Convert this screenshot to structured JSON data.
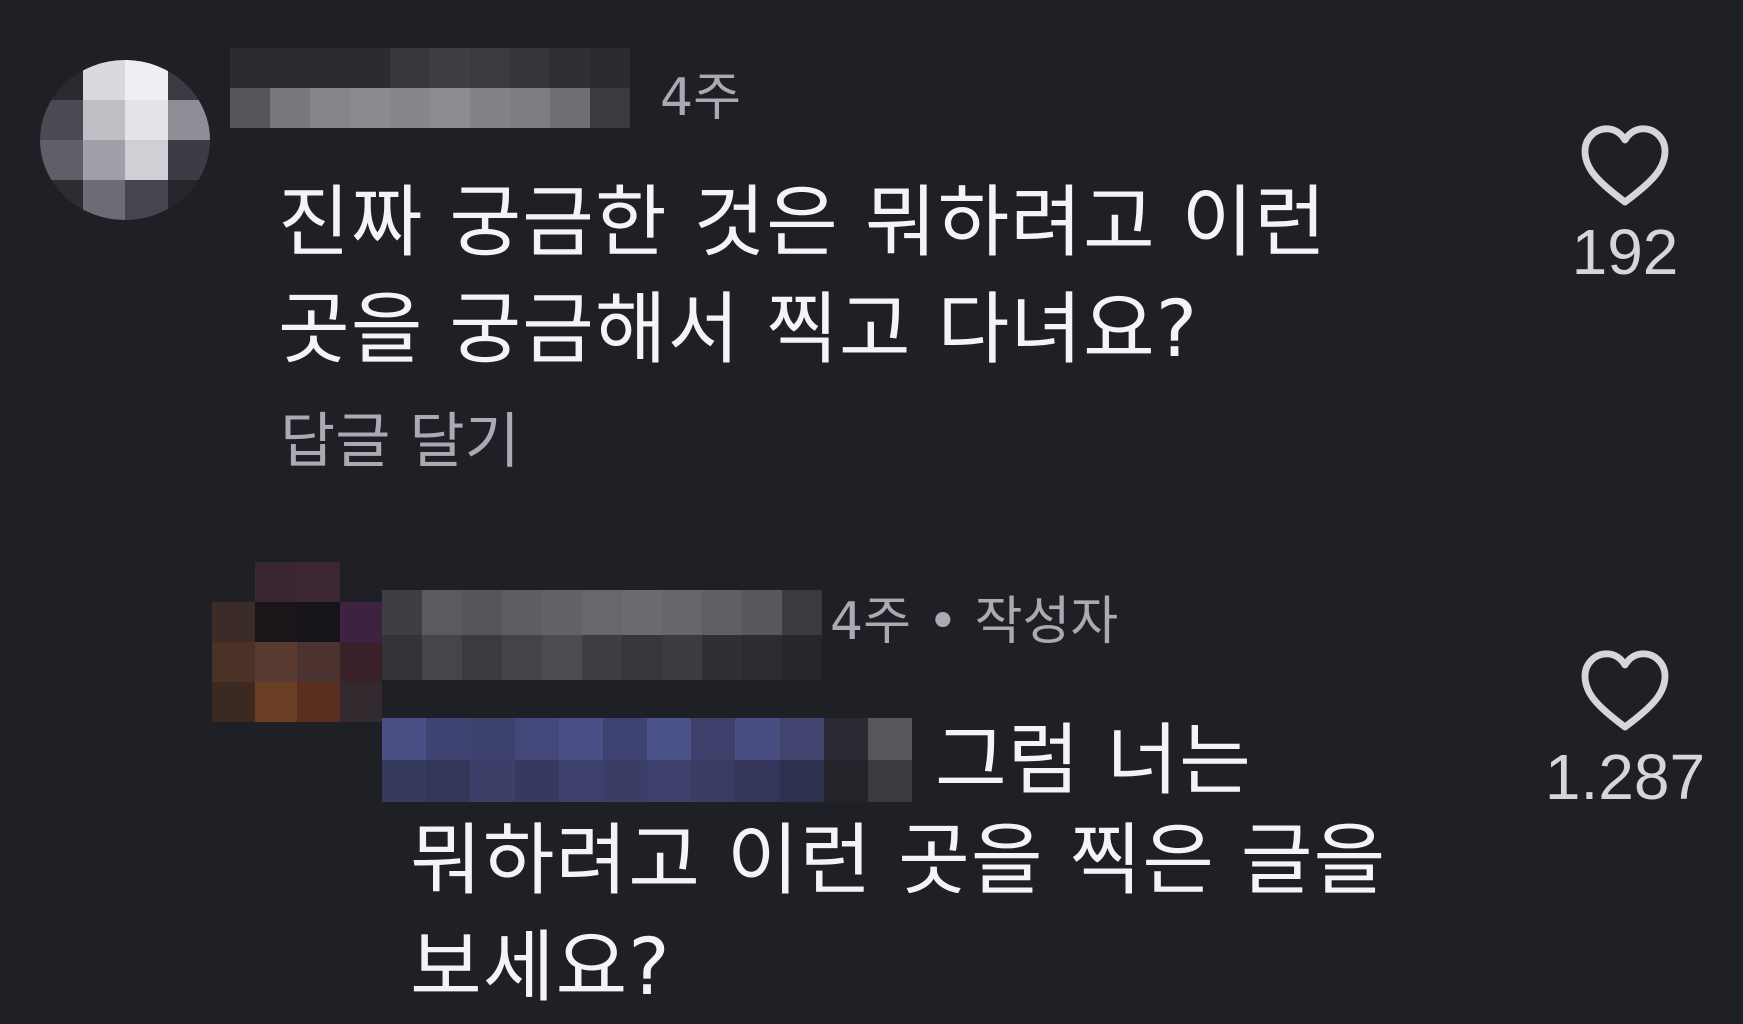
{
  "comments": [
    {
      "time": "4주",
      "author_badge": "",
      "text": "진짜 궁금한 것은 뭐하려고 이런\n곳을 궁금해서 찍고 다녀요?",
      "reply_label": "답글 달기",
      "likes": "192"
    },
    {
      "time": "4주",
      "author_badge": "• 작성자",
      "text_first_line": "그럼 너는",
      "text": "뭐하려고 이런 곳을 찍은 글을\n보세요?",
      "likes": "1.287"
    }
  ],
  "icons": {
    "like": "heart-outline-icon"
  },
  "colors": {
    "background": "#1f2026",
    "primary_text": "#f4f4f6",
    "secondary_text": "#a9aab2"
  }
}
